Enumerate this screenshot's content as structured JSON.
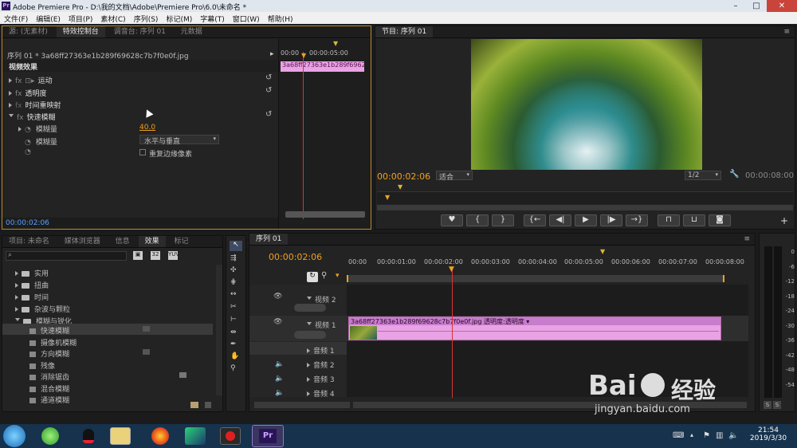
{
  "window": {
    "title": "Adobe Premiere Pro - D:\\我的文档\\Adobe\\Premiere Pro\\6.0\\未命名 *",
    "icon": "Pr"
  },
  "menu": [
    "文件(F)",
    "编辑(E)",
    "项目(P)",
    "素材(C)",
    "序列(S)",
    "标记(M)",
    "字幕(T)",
    "窗口(W)",
    "帮助(H)"
  ],
  "source_tabs": [
    "源: (无素材)",
    "特效控制台",
    "调音台: 序列 01",
    "元数据"
  ],
  "effects_control": {
    "sequence_clip": "序列 01 * 3a68ff27363e1b289f69628c7b7f0e0f.jpg",
    "timecode_start": "00:00",
    "timecode_end": "00:00:05:00",
    "clip_label": "3a68ff27363e1b289f69628c7",
    "video_effects_label": "视频效果",
    "effects": [
      "运动",
      "透明度",
      "时间重映射",
      "快速模糊"
    ],
    "blurriness_label": "模糊量",
    "blurriness_value": "40.0",
    "blur_dimension_label": "模糊量",
    "blur_dimension_value": "水平与垂直",
    "repeat_edge_label": "重复边缘像素",
    "current_time": "00:00:02:06"
  },
  "program": {
    "tab": "节目: 序列 01",
    "timecode": "00:00:02:06",
    "fit": "适合",
    "resolution": "1/2",
    "duration": "00:00:08:00"
  },
  "project_tabs": [
    "项目: 未命名",
    "媒体浏览器",
    "信息",
    "效果",
    "标记"
  ],
  "effects_panel": {
    "search_placeholder": "",
    "folders": [
      "实用",
      "扭曲",
      "时间",
      "杂波与颗粒",
      "模糊与锐化"
    ],
    "blur_items": [
      "快速模糊",
      "摄像机模糊",
      "方向模糊",
      "残像",
      "消除锯齿",
      "混合模糊",
      "通道模糊"
    ]
  },
  "timeline": {
    "tab": "序列 01",
    "timecode": "00:00:02:06",
    "ruler": [
      "00:00",
      "00:00:01:00",
      "00:00:02:00",
      "00:00:03:00",
      "00:00:04:00",
      "00:00:05:00",
      "00:00:06:00",
      "00:00:07:00",
      "00:00:08:00"
    ],
    "video_tracks": [
      "视频 2",
      "视频 1"
    ],
    "audio_tracks": [
      "音频 1",
      "音频 2",
      "音频 3",
      "音频 4"
    ],
    "clip_name": "3a68ff27363e1b289f69628c7b7f0e0f.jpg",
    "clip_effect": "透明度:透明度"
  },
  "meter": {
    "scale": [
      "0",
      "-6",
      "-12",
      "-18",
      "-24",
      "-30",
      "-36",
      "-42",
      "-48",
      "-54"
    ],
    "solo": [
      "S",
      "S"
    ]
  },
  "watermark": {
    "brand": "Bai",
    "brand2": "经验",
    "url": "jingyan.baidu.com"
  },
  "taskbar": {
    "time": "21:54",
    "date": "2019/3/30"
  }
}
